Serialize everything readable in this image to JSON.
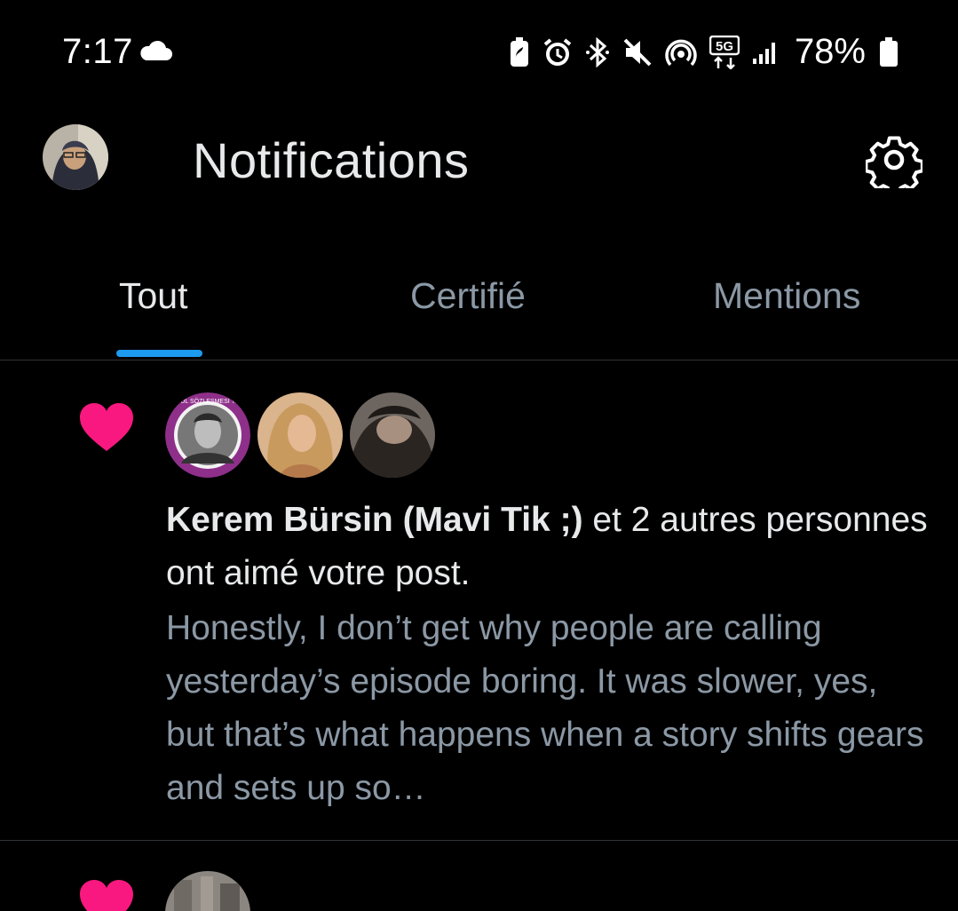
{
  "status_bar": {
    "time": "7:17",
    "battery": "78%",
    "icons": [
      "cloud-icon",
      "battery-saver-icon",
      "alarm-icon",
      "bluetooth-icon",
      "mute-icon",
      "hotspot-icon",
      "5g-icon",
      "signal-icon",
      "battery-icon"
    ]
  },
  "header": {
    "title": "Notifications"
  },
  "tabs": [
    {
      "label": "Tout",
      "active": true
    },
    {
      "label": "Certifié",
      "active": false
    },
    {
      "label": "Mentions",
      "active": false
    }
  ],
  "notification": {
    "name": "Kerem Bürsin (Mavi Tik ;)",
    "action": " et 2 autres personnes ont aimé votre post.",
    "excerpt": "Honestly, I don’t get why people are calling yesterday’s episode boring. It was slower, yes, but that’s what happens when a story shifts gears and sets up so…"
  },
  "colors": {
    "accent": "#1d9bf0",
    "like": "#f91880",
    "secondary_text": "#8b98a5",
    "divider": "#2f3336"
  }
}
